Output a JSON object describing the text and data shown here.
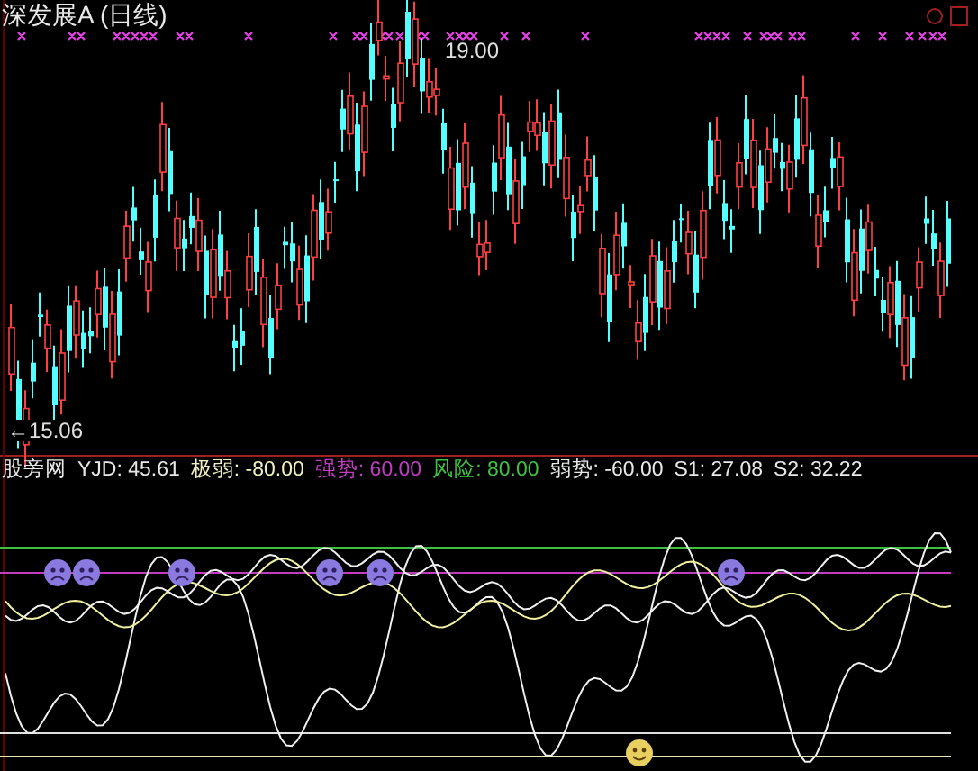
{
  "title": "深发展A (日线)",
  "price_high": "19.00",
  "price_low": "←15.06",
  "indicator": {
    "name": "股旁网",
    "readings": [
      {
        "text": "YJD: 45.61",
        "color": "#e8e8e8"
      },
      {
        "text": "极弱: -80.00",
        "color": "#f0f0c0"
      },
      {
        "text": "强势: 60.00",
        "color": "#c03cc0"
      },
      {
        "text": "风险: 80.00",
        "color": "#40c040"
      },
      {
        "text": "弱势: -60.00",
        "color": "#e8e8e8"
      },
      {
        "text": "S1: 27.08",
        "color": "#e8e8e8"
      },
      {
        "text": "S2: 32.22",
        "color": "#e8e8e8"
      }
    ]
  }
}
